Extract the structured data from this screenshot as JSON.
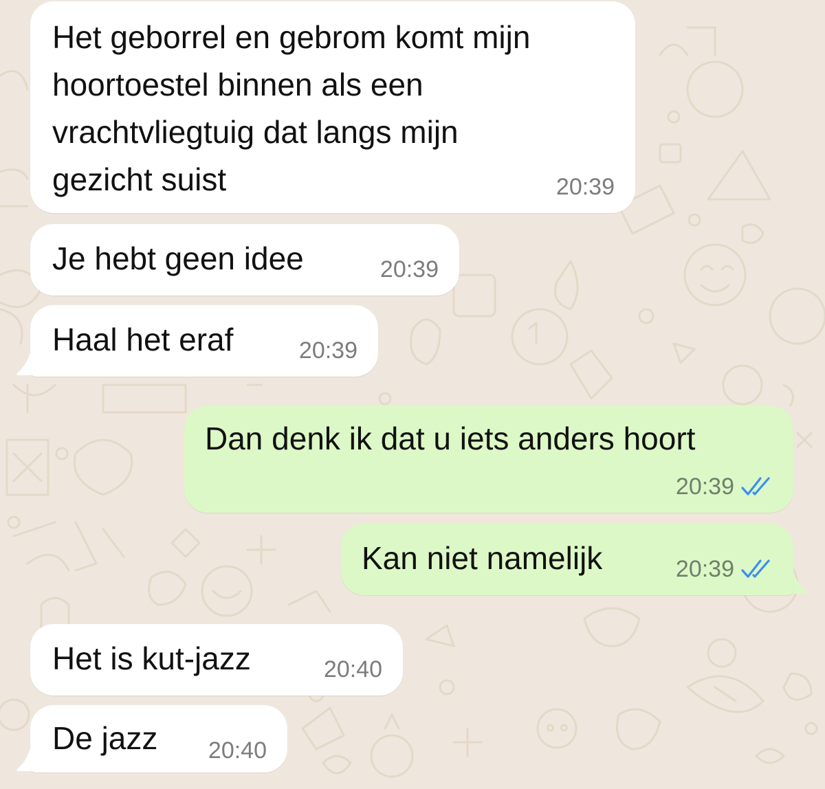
{
  "colors": {
    "wallpaper": "#efe7dd",
    "incoming_bubble": "#ffffff",
    "outgoing_bubble": "#dcf8c6",
    "read_ticks": "#3a8ff2",
    "timestamp": "#7c7c7c"
  },
  "messages": [
    {
      "direction": "incoming",
      "text": "Het geborrel en gebrom komt mijn\nhoortoestel binnen als een\nvrachtvliegtuig dat langs mijn\ngezicht suist",
      "time": "20:39"
    },
    {
      "direction": "incoming",
      "text": "Je hebt geen idee",
      "time": "20:39"
    },
    {
      "direction": "incoming",
      "text": "Haal het eraf",
      "time": "20:39"
    },
    {
      "direction": "outgoing",
      "text": "Dan denk ik dat u iets anders hoort",
      "time": "20:39",
      "status_icon": "double-check-read-icon"
    },
    {
      "direction": "outgoing",
      "text": "Kan niet namelijk",
      "time": "20:39",
      "status_icon": "double-check-read-icon"
    },
    {
      "direction": "incoming",
      "text": "Het is kut-jazz",
      "time": "20:40"
    },
    {
      "direction": "incoming",
      "text": "De jazz",
      "time": "20:40"
    }
  ]
}
